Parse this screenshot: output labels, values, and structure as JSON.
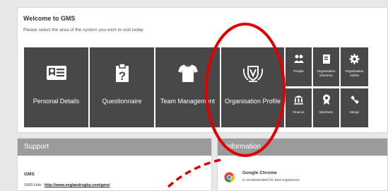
{
  "welcome": {
    "title": "Welcome to GMS",
    "subtitle": "Please select the area of the system you wish to visit today"
  },
  "tiles": [
    {
      "label": "Personal Details",
      "icon": "id-card-icon"
    },
    {
      "label": "Questionnaire",
      "icon": "clipboard-question-icon"
    },
    {
      "label": "Team Management",
      "icon": "shirt-icon"
    },
    {
      "label": "Organisation Profile",
      "icon": "shield-badge-icon"
    }
  ],
  "small_tiles": [
    {
      "label": "People",
      "icon": "people-icon"
    },
    {
      "label": "Organisation Directory",
      "icon": "book-icon"
    },
    {
      "label": "Organisation Admin",
      "icon": "gear-icon"
    },
    {
      "label": "Finance",
      "icon": "bank-icon"
    },
    {
      "label": "Members",
      "icon": "rosette-icon"
    },
    {
      "label": "Merge",
      "icon": "merge-icon"
    }
  ],
  "support": {
    "title": "Support",
    "gms_title": "GMS",
    "hub_prefix": "GMS Hub - ",
    "hub_link": "http://www.englandrugby.com/gms/"
  },
  "information": {
    "title": "Information",
    "chrome_name": "Google Chrome",
    "chrome_note": "is recommended for best experience"
  },
  "colors": {
    "tile": "#484848",
    "panel_header": "#9b9b9b",
    "annotation": "#e00000"
  }
}
